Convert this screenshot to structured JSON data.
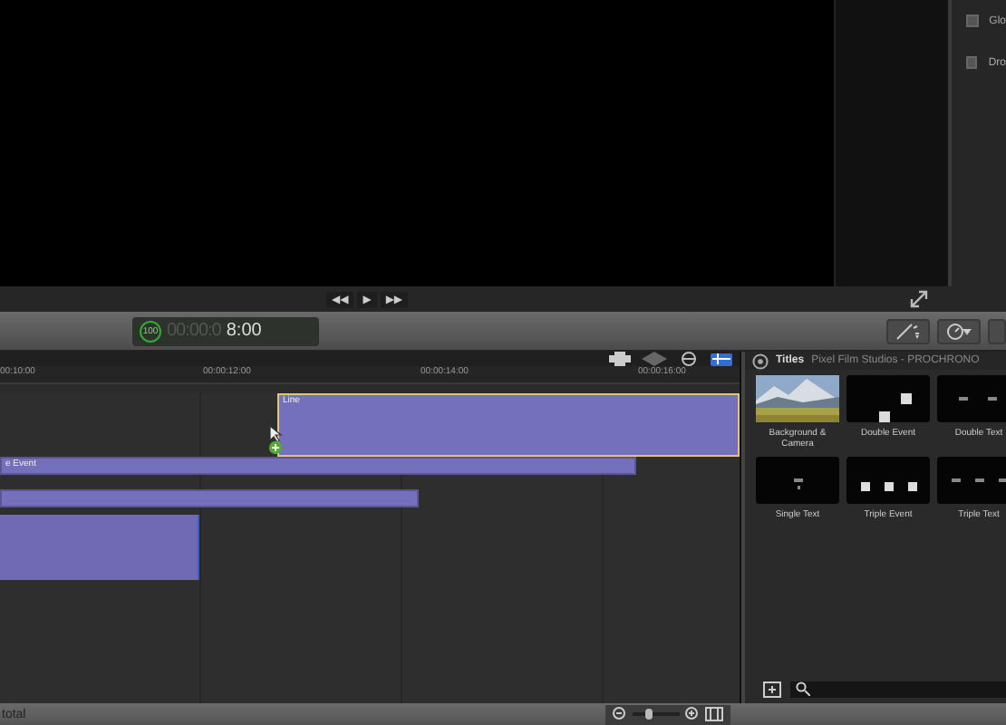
{
  "inspector": {
    "items": [
      {
        "label": "Glo",
        "checked": false
      },
      {
        "label": "Dro",
        "checked": false
      }
    ]
  },
  "transport": {
    "buttons": [
      "◀◀",
      "▶",
      "▶▶"
    ]
  },
  "dashboard": {
    "percent": "100",
    "timecode_dim": "00:00:0",
    "timecode": "8:00"
  },
  "timeline": {
    "ruler": [
      "00:10:00",
      "00:00:12:00",
      "00:00:14:00",
      "00:00:16:00"
    ],
    "clips": [
      {
        "label": "Line",
        "selected": true,
        "kind": "title"
      },
      {
        "label": "e Event",
        "selected": false,
        "kind": "title"
      },
      {
        "selected": false,
        "kind": "title"
      },
      {
        "selected": false,
        "kind": "video"
      }
    ]
  },
  "zoom": {
    "level": 0.3
  },
  "browser": {
    "title": "Titles",
    "subtitle": "Pixel Film Studios - PROCHRONO",
    "items": [
      {
        "label": "Background & Camera",
        "selected": false
      },
      {
        "label": "Double Event",
        "kind": "event2",
        "selected": false
      },
      {
        "label": "Double Text",
        "kind": "text2",
        "selected": false
      },
      {
        "label": "Single Text",
        "kind": "text1",
        "selected": false
      },
      {
        "label": "Triple Event",
        "kind": "event3",
        "selected": false
      },
      {
        "label": "Triple Text",
        "kind": "text3",
        "selected": false
      }
    ]
  },
  "status_bar": {
    "text": "total"
  }
}
